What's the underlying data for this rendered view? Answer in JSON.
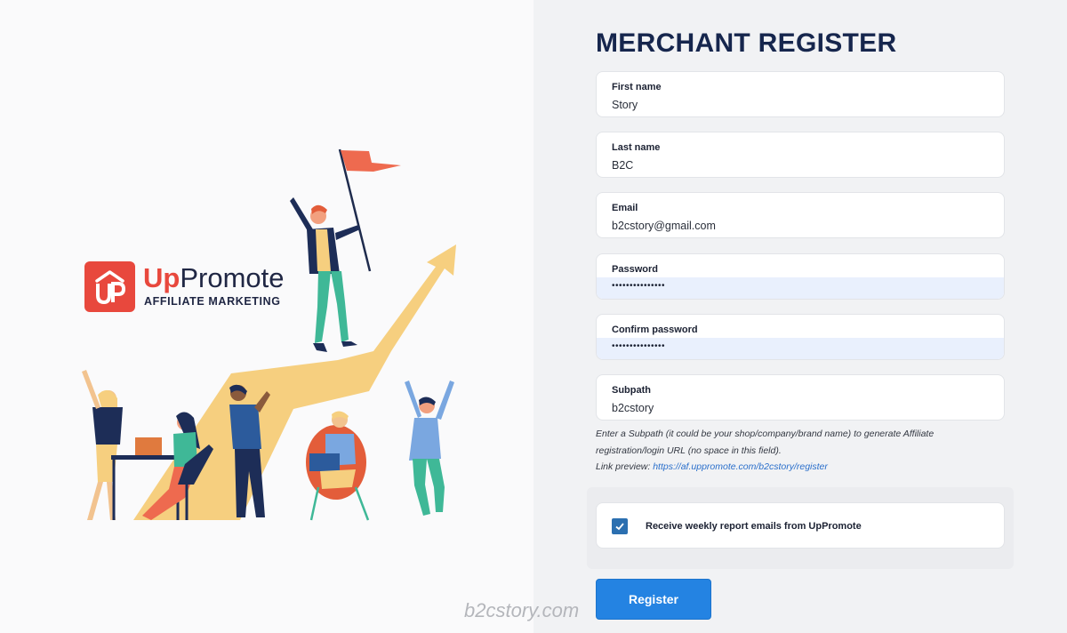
{
  "brand": {
    "logo_up": "Up",
    "logo_promote": "Promote",
    "logo_subtitle": "AFFILIATE MARKETING",
    "accent_color": "#e8483d",
    "navy_color": "#202744"
  },
  "form": {
    "title": "MERCHANT REGISTER",
    "fields": {
      "first_name": {
        "label": "First name",
        "value": "Story"
      },
      "last_name": {
        "label": "Last name",
        "value": "B2C"
      },
      "email": {
        "label": "Email",
        "value": "b2cstory@gmail.com"
      },
      "password": {
        "label": "Password",
        "value": "•••••••••••••••"
      },
      "confirm_password": {
        "label": "Confirm password",
        "value": "•••••••••••••••"
      },
      "subpath": {
        "label": "Subpath",
        "value": "b2cstory"
      }
    },
    "help_text": "Enter a Subpath (it could be your shop/company/brand name) to generate Affiliate registration/login URL (no space in this field).",
    "link_preview_label": "Link preview: ",
    "link_preview_url": "https://af.uppromote.com/b2cstory/register",
    "checkbox": {
      "label": "Receive weekly report emails from UpPromote",
      "checked": true
    },
    "register_button": "Register",
    "button_color": "#2483e2"
  },
  "watermark": "b2cstory.com"
}
